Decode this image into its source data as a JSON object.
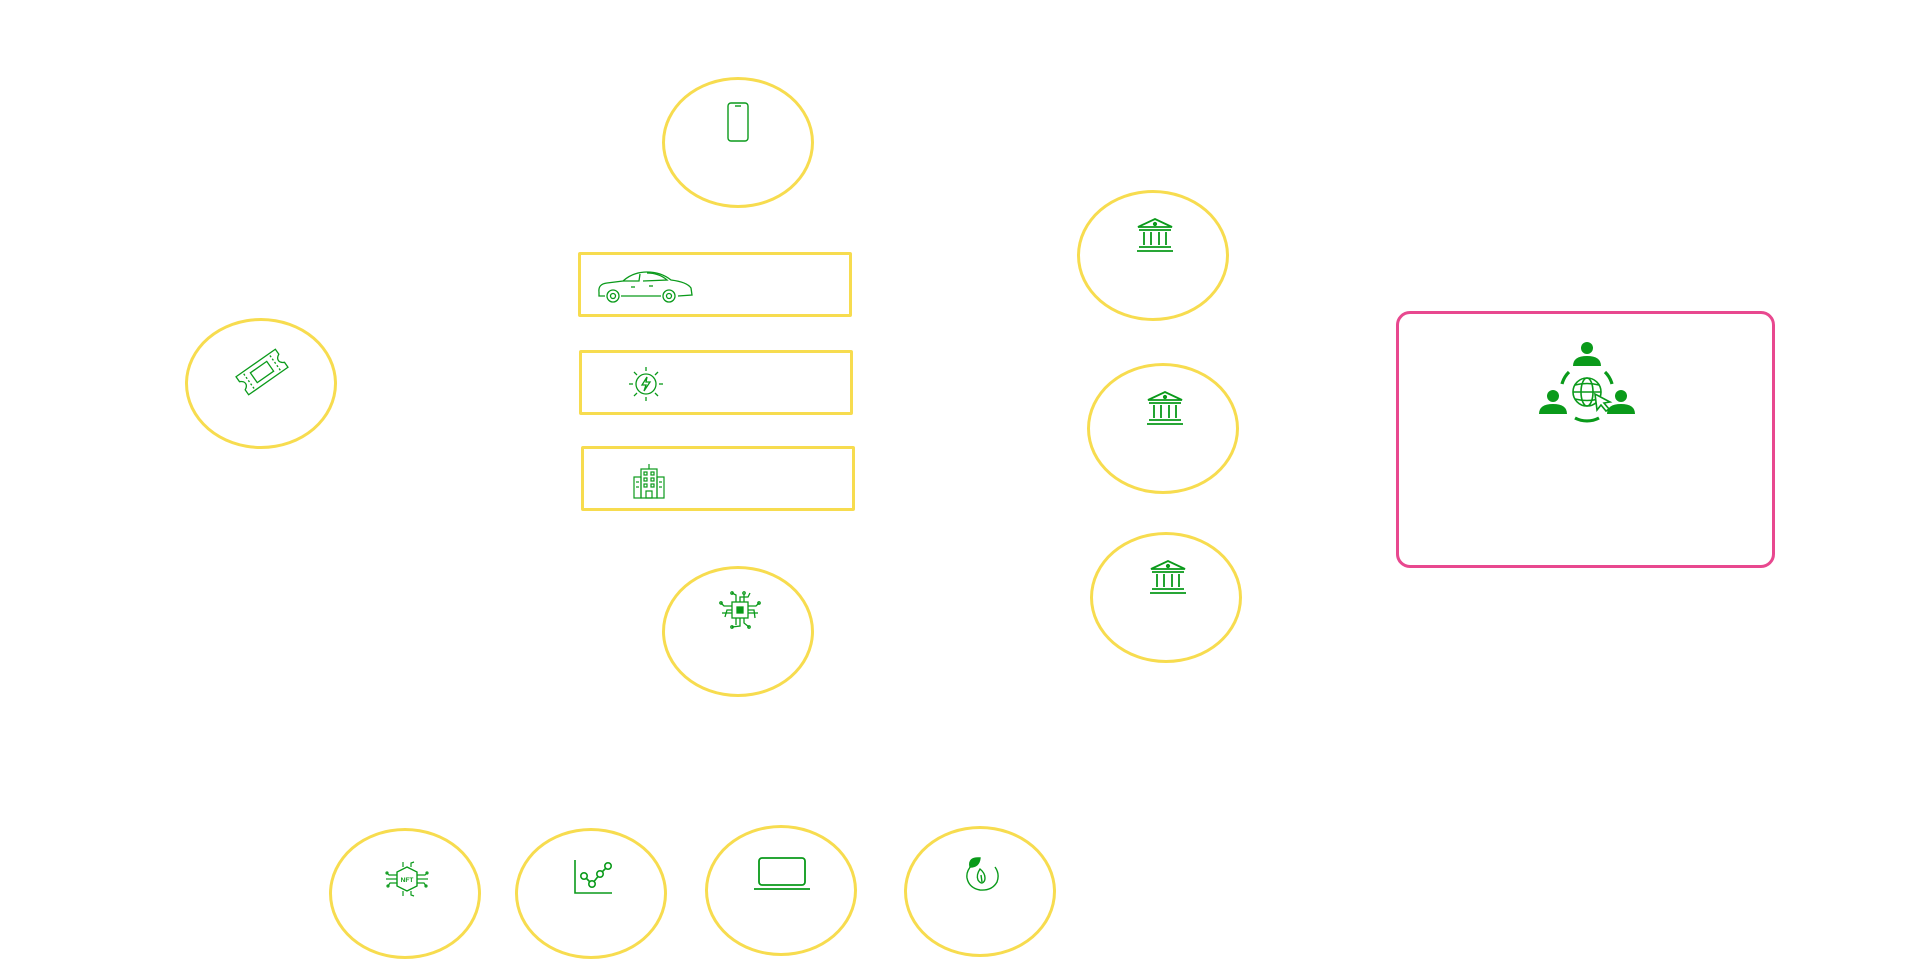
{
  "diagram": {
    "colors": {
      "node_border": "#f7dc4f",
      "panel_border": "#e8488f",
      "icon_stroke": "#0a9a1a",
      "background": "#ffffff"
    },
    "nodes": [
      {
        "id": "smartphone",
        "shape": "oval",
        "icon": "smartphone-icon"
      },
      {
        "id": "electric-car",
        "shape": "rectangle",
        "icon": "car-icon"
      },
      {
        "id": "solar-energy",
        "shape": "rectangle",
        "icon": "sun-bolt-icon"
      },
      {
        "id": "building",
        "shape": "rectangle",
        "icon": "office-building-icon"
      },
      {
        "id": "microchip",
        "shape": "oval",
        "icon": "microchip-icon"
      },
      {
        "id": "ticket",
        "shape": "oval",
        "icon": "ticket-icon"
      },
      {
        "id": "bank-1",
        "shape": "oval",
        "icon": "bank-icon"
      },
      {
        "id": "bank-2",
        "shape": "oval",
        "icon": "bank-icon"
      },
      {
        "id": "bank-3",
        "shape": "oval",
        "icon": "bank-icon"
      },
      {
        "id": "nft",
        "shape": "oval",
        "icon": "nft-chip-icon"
      },
      {
        "id": "analytics",
        "shape": "oval",
        "icon": "line-chart-icon"
      },
      {
        "id": "laptop",
        "shape": "oval",
        "icon": "laptop-icon"
      },
      {
        "id": "eco-energy",
        "shape": "oval",
        "icon": "leaf-bulb-icon"
      },
      {
        "id": "global-network",
        "shape": "rounded-rectangle",
        "icon": "global-network-people-icon"
      }
    ]
  }
}
